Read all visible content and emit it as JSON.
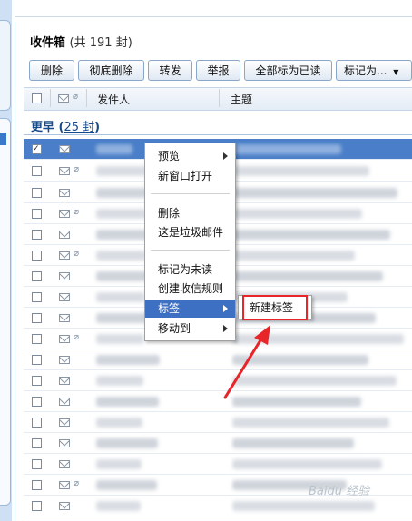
{
  "mailbox": {
    "title": "收件箱",
    "count": "(共 191 封)"
  },
  "toolbar": {
    "delete": "删除",
    "delete_perm": "彻底删除",
    "forward": "转发",
    "report": "举报",
    "mark_all_read": "全部标为已读",
    "mark_as": "标记为...",
    "mark_as_arrow": "▼"
  },
  "columns": {
    "sender": "发件人",
    "subject": "主题"
  },
  "group": {
    "label": "更早",
    "count": "25 封"
  },
  "context_menu": {
    "preview": "预览",
    "open_new_window": "新窗口打开",
    "delete": "删除",
    "spam": "这是垃圾邮件",
    "mark_unread": "标记为未读",
    "create_rule": "创建收信规则",
    "tag": "标签",
    "move_to": "移动到"
  },
  "submenu": {
    "new_tag": "新建标签"
  },
  "annotation": {
    "color": "#e8262a"
  },
  "watermark": "Baidu 经验"
}
